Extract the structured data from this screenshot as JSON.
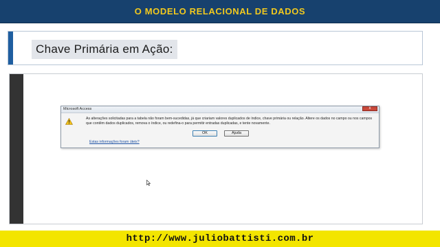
{
  "header": {
    "title": "O MODELO RELACIONAL DE DADOS"
  },
  "slide": {
    "subtitle": "Chave Primária em Ação:"
  },
  "dialog": {
    "title": "Microsoft Access",
    "message": "As alterações solicitadas para a tabela não foram bem-sucedidas, já que criariam valores duplicados de índice, chave primária ou relação. Altere os dados no campo ou nos campos que contêm dados duplicados, remova o índice, ou redefina-o para permitir entradas duplicadas, e tente novamente.",
    "ok_label": "OK",
    "help_label": "Ajuda",
    "help_link": "Estas informações foram úteis?",
    "close_glyph": "x",
    "icon": "warning-icon"
  },
  "footer": {
    "url": "http://www.juliobattisti.com.br"
  },
  "colors": {
    "header_bg": "#17416e",
    "header_text": "#f2c91e",
    "footer_bg": "#f3e500",
    "accent": "#1f5ea0"
  }
}
